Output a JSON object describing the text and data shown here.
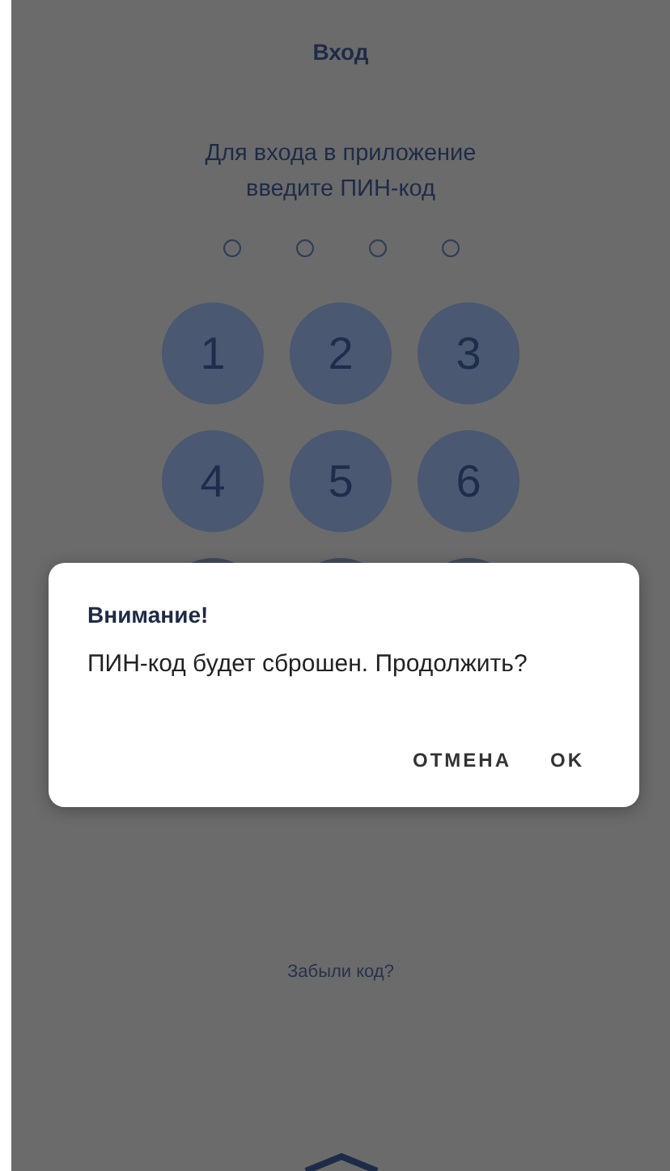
{
  "header": {
    "title": "Вход"
  },
  "prompt": "Для входа в приложение введите ПИН-код",
  "pin_dots": [
    {
      "filled": false
    },
    {
      "filled": false
    },
    {
      "filled": false
    },
    {
      "filled": false
    }
  ],
  "keypad": [
    {
      "kind": "digit",
      "label": "1"
    },
    {
      "kind": "digit",
      "label": "2"
    },
    {
      "kind": "digit",
      "label": "3"
    },
    {
      "kind": "digit",
      "label": "4"
    },
    {
      "kind": "digit",
      "label": "5"
    },
    {
      "kind": "digit",
      "label": "6"
    },
    {
      "kind": "covered"
    },
    {
      "kind": "covered"
    },
    {
      "kind": "covered"
    }
  ],
  "forgot_link": "Забыли код?",
  "dialog": {
    "title": "Внимание!",
    "message": "ПИН-код будет сброшен. Продолжить?",
    "buttons": [
      "ОТМЕНА",
      "OK"
    ]
  }
}
